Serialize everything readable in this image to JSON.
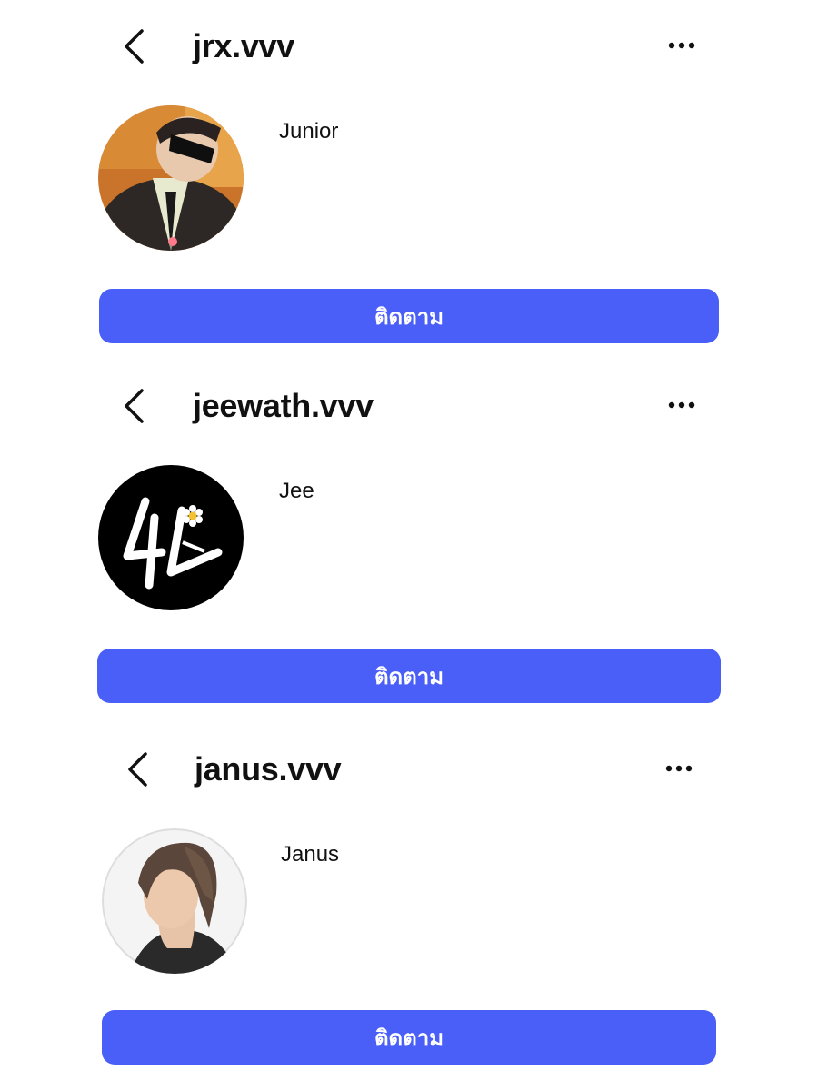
{
  "profiles": [
    {
      "username": "jrx.vvv",
      "display_name": "Junior",
      "follow_label": "ติดตาม",
      "avatar_description": "profile-photo-sunglasses-suit"
    },
    {
      "username": "jeewath.vvv",
      "display_name": "Jee",
      "follow_label": "ติดตาม",
      "avatar_description": "profile-logo-4l-daisy"
    },
    {
      "username": "janus.vvv",
      "display_name": "Janus",
      "follow_label": "ติดตาม",
      "avatar_description": "profile-photo-side-portrait"
    }
  ],
  "icons": {
    "back": "chevron-left-icon",
    "more": "more-horizontal-icon"
  },
  "colors": {
    "follow_button": "#4a5ff8",
    "follow_text": "#ffffff",
    "text": "#111111",
    "background": "#ffffff"
  }
}
